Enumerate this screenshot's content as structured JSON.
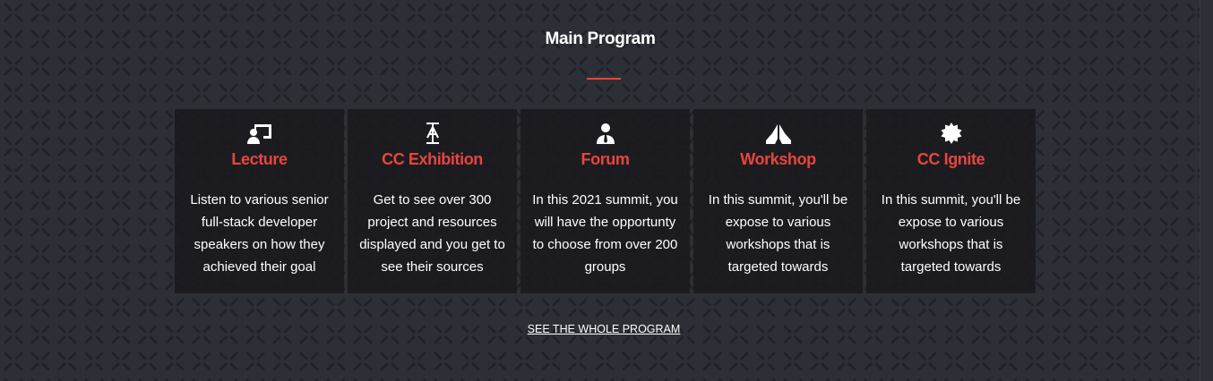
{
  "title": "Main Program",
  "accent": "#e8453c",
  "cards": [
    {
      "icon": "presentation-icon",
      "title": "Lecture",
      "text": "Listen to various senior full-stack developer speakers on how they achieved their goal"
    },
    {
      "icon": "text-cursor-icon",
      "title": "CC Exhibition",
      "text": "Get to see over 300 project and resources displayed and you get to see their sources"
    },
    {
      "icon": "user-tie-icon",
      "title": "Forum",
      "text": "In this 2021 summit, you will have the opportunty to choose from over 200 groups"
    },
    {
      "icon": "praying-hands-icon",
      "title": "Workshop",
      "text": "In this summit, you'll be expose to various workshops that is targeted towards"
    },
    {
      "icon": "badge-icon",
      "title": "CC Ignite",
      "text": "In this summit, you'll be expose to various workshops that is targeted towards"
    }
  ],
  "link": "SEE THE WHOLE PROGRAM"
}
